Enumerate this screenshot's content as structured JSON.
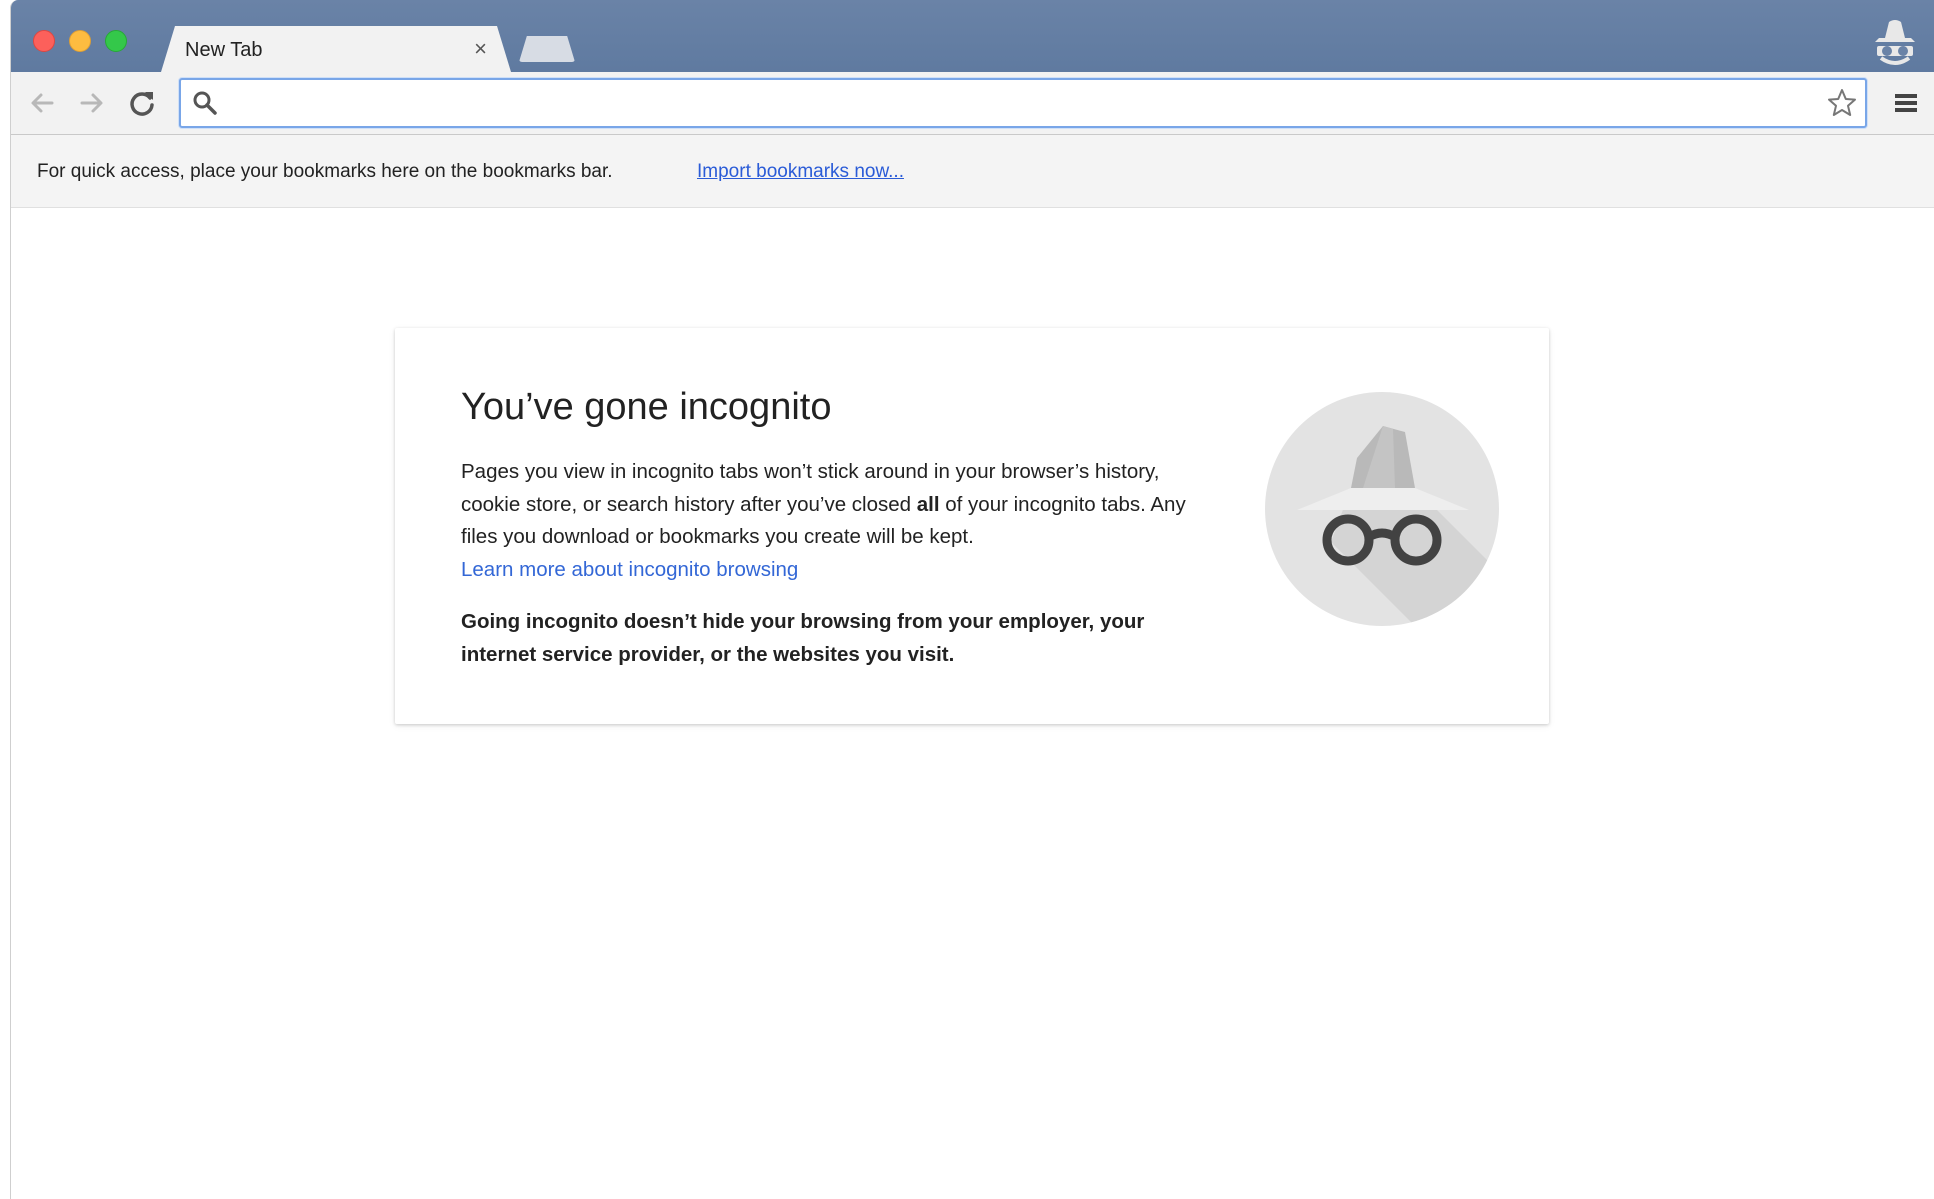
{
  "window": {
    "tab_title": "New Tab",
    "tab_close_glyph": "×"
  },
  "toolbar": {
    "address_value": "",
    "icons": [
      "back-icon",
      "forward-icon",
      "reload-icon",
      "search-icon",
      "bookmark-star-icon",
      "menu-icon"
    ]
  },
  "bookmarks_bar": {
    "message": "For quick access, place your bookmarks here on the bookmarks bar.",
    "import_link": "Import bookmarks now..."
  },
  "incognito_card": {
    "title": "You’ve gone incognito",
    "body_part1": "Pages you view in incognito tabs won’t stick around in your browser’s history, cookie store, or search history after you’ve closed ",
    "body_bold": "all",
    "body_part2": " of your incognito tabs. Any files you download or bookmarks you create will be kept.",
    "learn_more_link": "Learn more about incognito browsing",
    "warning": "Going incognito doesn’t hide your browsing from your employer, your internet service provider, or the websites you visit."
  },
  "colors": {
    "titlebar": "#5f7aa0",
    "toolbar": "#f2f2f2",
    "omnibox_focus": "#79a6e8",
    "link": "#3367d6"
  }
}
